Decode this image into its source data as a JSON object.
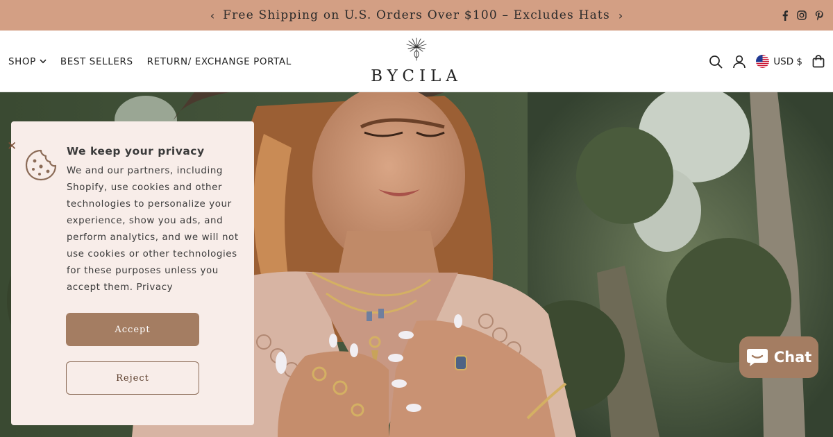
{
  "announcement": {
    "text": "Free Shipping on U.S. Orders Over $100 – Excludes Hats",
    "prev": "‹",
    "next": "›",
    "background": "#d39f84"
  },
  "socials": [
    "facebook-icon",
    "instagram-icon",
    "pinterest-icon"
  ],
  "nav": {
    "items": [
      {
        "label": "SHOP",
        "has_dropdown": true
      },
      {
        "label": "BEST SELLERS"
      },
      {
        "label": "RETURN/ EXCHANGE PORTAL"
      }
    ]
  },
  "logo": {
    "text": "BYCILA"
  },
  "header_actions": {
    "icons": [
      "search-icon",
      "account-icon",
      "cart-icon"
    ],
    "currency": "USD $",
    "currency_flag": "us-flag-icon"
  },
  "privacy": {
    "title": "We keep your privacy",
    "body": "We and our partners, including Shopify, use cookies and other technologies to personalize your experience, show you ads, and perform analytics, and we will not use cookies or other technologies for these purposes unless you accept them. Privacy",
    "accept": "Accept",
    "reject": "Reject",
    "close": "✕",
    "accent": "#a47d62",
    "card_background": "#f8ede9"
  },
  "chat": {
    "label": "Chat",
    "color": "#a47d62"
  }
}
